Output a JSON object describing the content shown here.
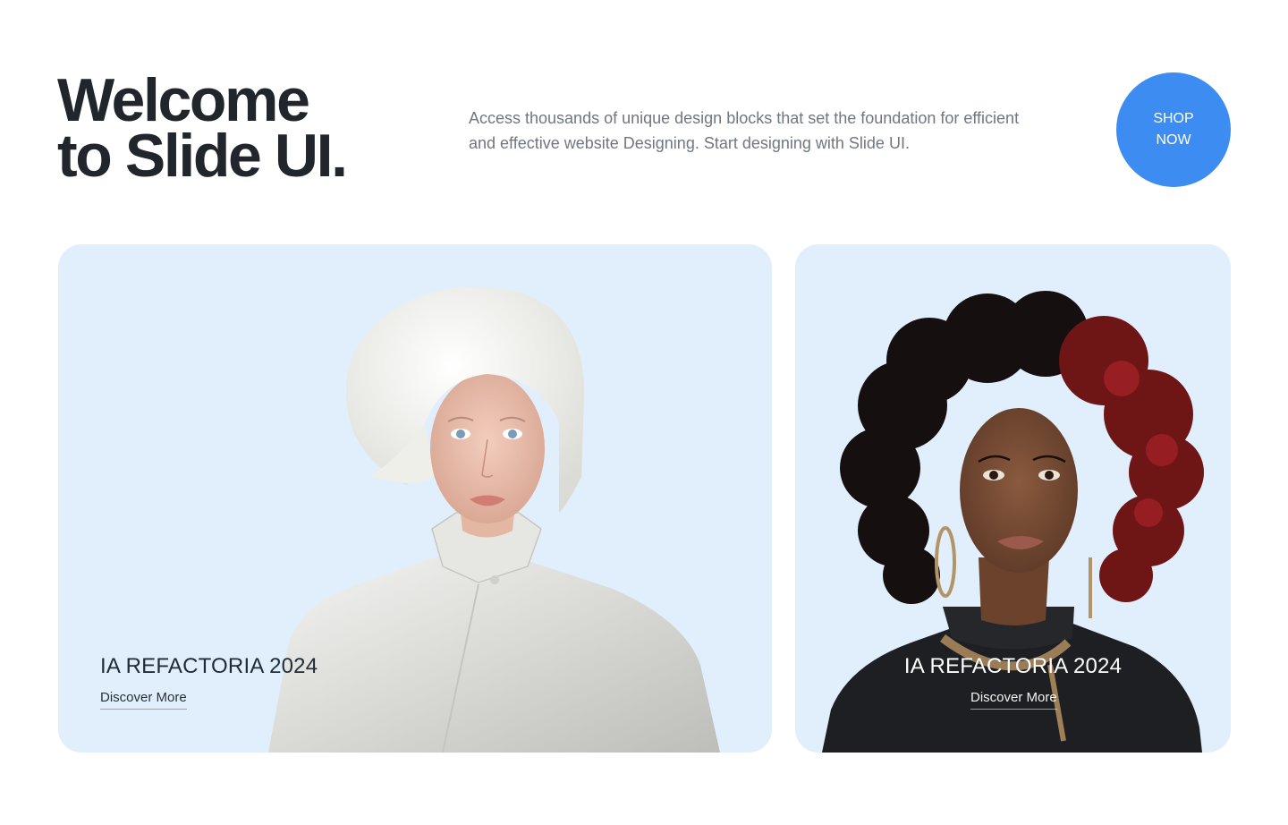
{
  "hero": {
    "headline_line1": "Welcome",
    "headline_line2": "to Slide UI.",
    "description": "Access thousands of unique design blocks that set the foundation for efficient and effective website Designing. Start designing with Slide UI.",
    "cta_label": "SHOP NOW"
  },
  "cards": [
    {
      "title": "IA REFACTORIA 2024",
      "link_label": "Discover More"
    },
    {
      "title": "IA REFACTORIA 2024",
      "link_label": "Discover More"
    }
  ],
  "colors": {
    "accent": "#3d8cf1",
    "card_background": "#e1effc",
    "headline": "#20262b",
    "body_text": "#6f7780"
  }
}
